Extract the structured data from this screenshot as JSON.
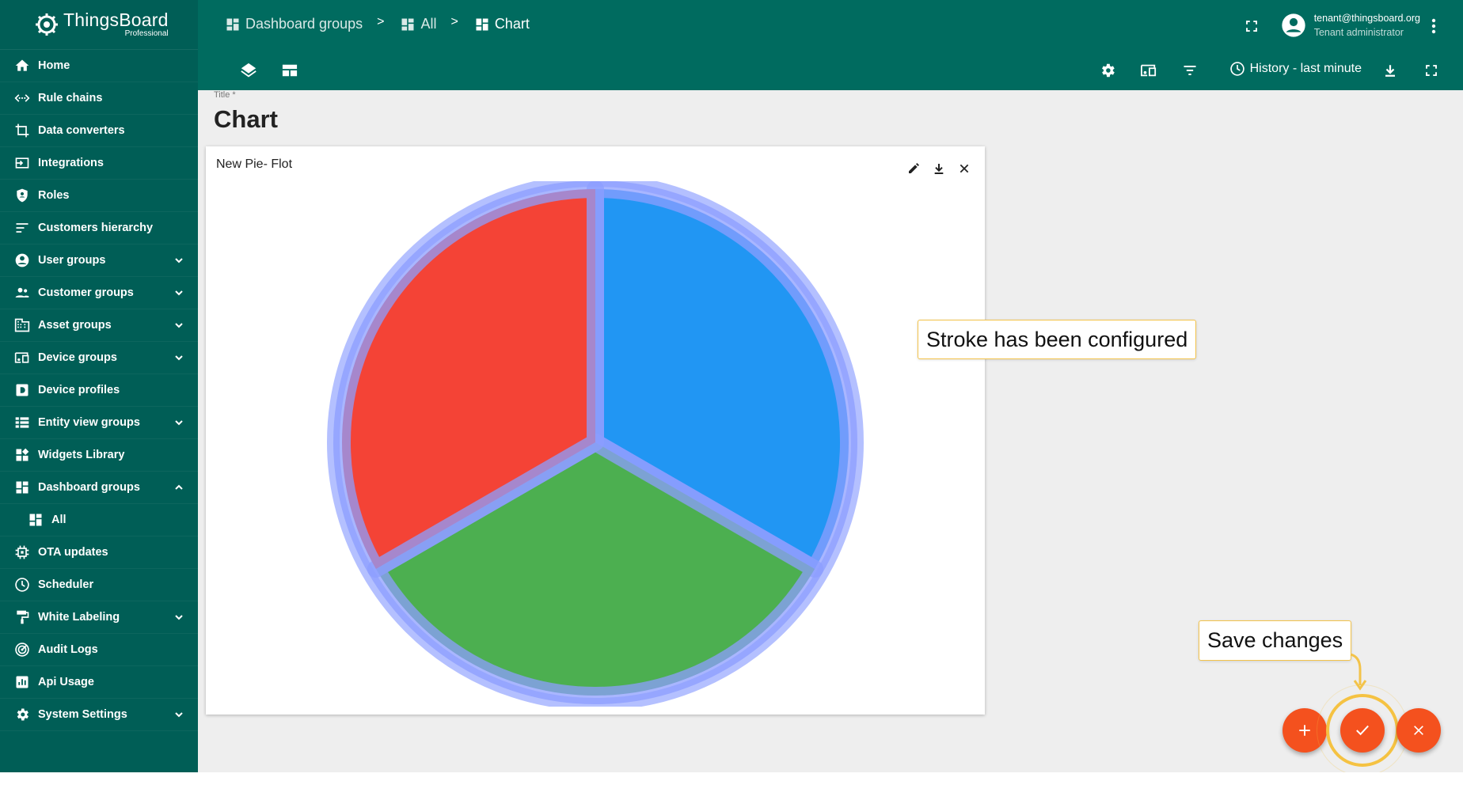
{
  "app": {
    "brand": "ThingsBoard",
    "edition": "Professional"
  },
  "sidebar": {
    "items": [
      {
        "label": "Home",
        "icon": "home-icon"
      },
      {
        "label": "Rule chains",
        "icon": "rule-chains-icon"
      },
      {
        "label": "Data converters",
        "icon": "converter-icon"
      },
      {
        "label": "Integrations",
        "icon": "integration-icon"
      },
      {
        "label": "Roles",
        "icon": "shield-icon"
      },
      {
        "label": "Customers hierarchy",
        "icon": "hierarchy-icon"
      },
      {
        "label": "User groups",
        "icon": "account-circle-icon"
      },
      {
        "label": "Customer groups",
        "icon": "people-icon"
      },
      {
        "label": "Asset groups",
        "icon": "building-icon"
      },
      {
        "label": "Device groups",
        "icon": "devices-icon"
      },
      {
        "label": "Device profiles",
        "icon": "device-profile-icon"
      },
      {
        "label": "Entity view groups",
        "icon": "view-list-icon"
      },
      {
        "label": "Widgets Library",
        "icon": "widgets-icon"
      },
      {
        "label": "Dashboard groups",
        "icon": "dashboard-icon"
      },
      {
        "label": "All",
        "icon": "dashboard-icon"
      },
      {
        "label": "OTA updates",
        "icon": "chip-icon"
      },
      {
        "label": "Scheduler",
        "icon": "clock-icon"
      },
      {
        "label": "White Labeling",
        "icon": "paint-roller-icon"
      },
      {
        "label": "Audit Logs",
        "icon": "track-changes-icon"
      },
      {
        "label": "Api Usage",
        "icon": "bar-chart-icon"
      },
      {
        "label": "System Settings",
        "icon": "gear-icon"
      }
    ]
  },
  "header": {
    "breadcrumbs": [
      "Dashboard groups",
      "All",
      "Chart"
    ],
    "separator": ">",
    "user_email": "tenant@thingsboard.org",
    "user_role": "Tenant administrator",
    "history_label": "History - last minute"
  },
  "dashboard": {
    "title_label": "Title *",
    "title": "Chart"
  },
  "widget": {
    "title": "New Pie- Flot"
  },
  "chart_data": {
    "type": "pie",
    "title": "",
    "series": [
      {
        "value": 1,
        "color": "#2196f3"
      },
      {
        "value": 1,
        "color": "#4caf50"
      },
      {
        "value": 1,
        "color": "#f44336"
      }
    ],
    "stroke_color": "#8c9eff"
  },
  "tooltips": {
    "stroke": "Stroke has been configured",
    "save": "Save changes"
  },
  "colors": {
    "sidebar_bg": "#005e56",
    "header_bg": "#006b5f",
    "accent": "#f4511e",
    "highlight": "#f5c242"
  }
}
